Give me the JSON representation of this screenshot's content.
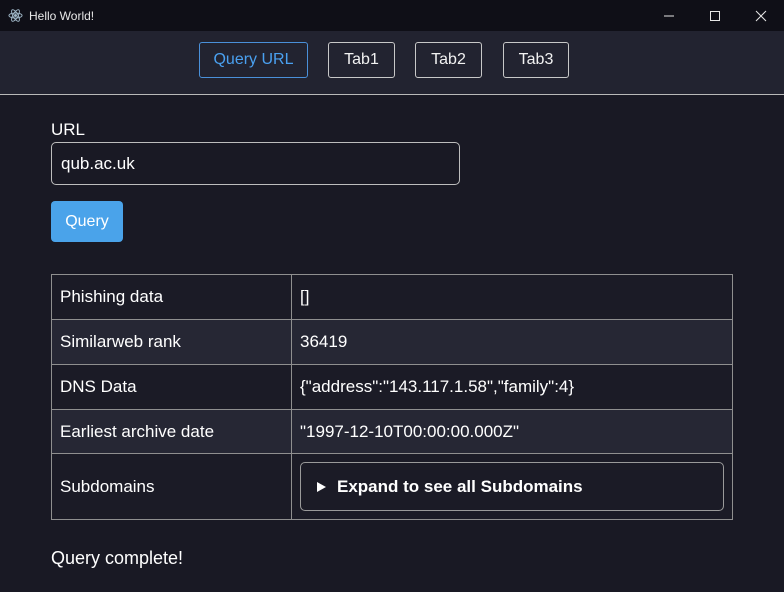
{
  "window": {
    "title": "Hello World!",
    "app_icon": "electron-icon",
    "controls": [
      "minimize-icon",
      "maximize-icon",
      "close-icon"
    ]
  },
  "nav": {
    "tabs": [
      {
        "label": "Query URL",
        "active": true
      },
      {
        "label": "Tab1",
        "active": false
      },
      {
        "label": "Tab2",
        "active": false
      },
      {
        "label": "Tab3",
        "active": false
      }
    ]
  },
  "form": {
    "url_label": "URL",
    "url_value": "qub.ac.uk",
    "query_label": "Query"
  },
  "results": {
    "rows": [
      {
        "key": "Phishing data",
        "value": "[]"
      },
      {
        "key": "Similarweb rank",
        "value": "36419"
      },
      {
        "key": "DNS Data",
        "value": "{\"address\":\"143.117.1.58\",\"family\":4}"
      },
      {
        "key": "Earliest archive date",
        "value": "\"1997-12-10T00:00:00.000Z\""
      },
      {
        "key": "Subdomains",
        "value": "Expand to see all Subdomains"
      }
    ]
  },
  "status": "Query complete!",
  "colors": {
    "accent": "#4aa3ea",
    "background": "#191924",
    "titlebar": "#0f0f17",
    "navbar": "#222330"
  }
}
